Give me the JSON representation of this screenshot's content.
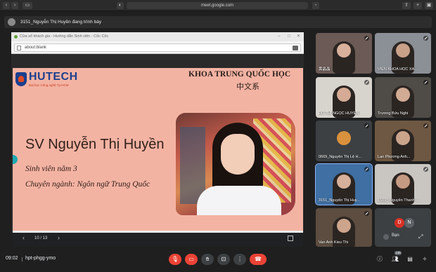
{
  "browser": {
    "url": "meet.google.com"
  },
  "presenting": {
    "text": "3151_Nguyễn Thị Huyền đang trình bày"
  },
  "shared_window": {
    "title": "Cửa sổ khách gia - Hướng dẫn Sinh viên - Cốc Cốc",
    "address": "about:blank"
  },
  "slide": {
    "logo_name": "HUTECH",
    "logo_sub": "Đại học Công nghệ Tp.HCM",
    "header": "KHOA TRUNG QUỐC HỌC",
    "header_zh": "中文系",
    "name": "SV Nguyễn Thị Huyền",
    "line1": "Sinh viên năm 3",
    "line2": "Chuyên ngành: Ngôn ngữ Trung Quốc",
    "page": "10 / 13"
  },
  "participants": [
    {
      "name": "黄晶晶",
      "bg": "#6b5a55",
      "skin": "#d9b09c"
    },
    {
      "name": "VIỆN KHOA HỌC XA...",
      "bg": "#8b8f96",
      "skin": "#c9a088"
    },
    {
      "name": "ĐỖ THỊ NGỌC HUYỀN",
      "bg": "#d7d3cd",
      "skin": "#d6ab95"
    },
    {
      "name": "Trương Bửu Nghi",
      "bg": "#4f4b46",
      "skin": "#d2ab94"
    },
    {
      "name": "0669_Nguyễn Thị Lệ H...",
      "bg": "#3c4043",
      "skin": "#d9913d"
    },
    {
      "name": "Lan Phương Anh...",
      "bg": "#6e5843",
      "skin": "#caa48b"
    },
    {
      "name": "3151_Nguyễn Thị Huy...",
      "bg": "#3f6fa3",
      "skin": "#d6b09a"
    },
    {
      "name": "1509_ Nguyễn Thanh ...",
      "bg": "#c9c6c2",
      "skin": "#c59a82"
    },
    {
      "name": "Van Anh Kieu Thi",
      "bg": "#5c4d40",
      "skin": "#cda48c"
    }
  ],
  "self": {
    "initials_d": "D",
    "initials_n": "N",
    "label": "Bạn"
  },
  "meeting": {
    "time": "09:02",
    "code": "hpt-phgg-ymo",
    "participants_count": "146"
  },
  "colors": {
    "slide_bg": "#f3b3a3",
    "hutech_blue": "#1b3f8f",
    "end_call": "#ea4335"
  }
}
